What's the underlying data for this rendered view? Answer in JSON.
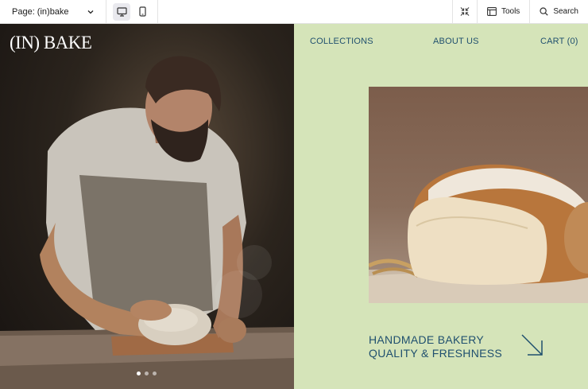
{
  "editor": {
    "page_label": "Page: (in)bake",
    "tools_label": "Tools",
    "search_label": "Search"
  },
  "site": {
    "logo": "(IN) BAKE",
    "nav": {
      "collections": "COLLECTIONS",
      "about": "ABOUT US",
      "cart": "CART (0)"
    },
    "tagline_line1": "HANDMADE BAKERY",
    "tagline_line2": "QUALITY & FRESHNESS",
    "carousel": {
      "count": 3,
      "active_index": 0
    }
  },
  "colors": {
    "panel_bg": "#d5e4b9",
    "accent_text": "#1f4f6e"
  }
}
